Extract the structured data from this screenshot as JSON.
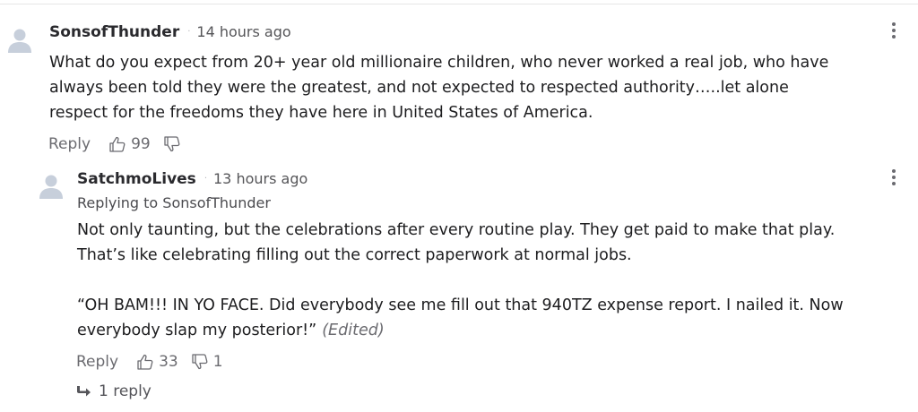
{
  "comments": [
    {
      "username": "SonsofThunder",
      "separator": "·",
      "time": "14 hours ago",
      "body_lines": [
        "What do you expect from 20+ year old millionaire children, who never worked a real job, who have",
        "always been told they were the greatest, and not expected to respected authority…..let alone",
        "respect for the freedoms they have here in United States of America."
      ],
      "reply_label": "Reply",
      "upvotes": "99",
      "downvotes": ""
    },
    {
      "username": "SatchmoLives",
      "separator": "·",
      "time": "13 hours ago",
      "replying_to": "Replying to SonsofThunder",
      "body_lines": [
        "Not only taunting, but the celebrations after every routine play. They get paid to make that play.",
        "That’s like celebrating filling out the correct paperwork at normal jobs.",
        "",
        "“OH BAM!!! IN YO FACE. Did everybody see me fill out that 940TZ expense report. I nailed it. Now",
        "everybody slap my posterior!”"
      ],
      "edited_label": "(Edited)",
      "reply_label": "Reply",
      "upvotes": "33",
      "downvotes": "1",
      "replies_label": "1 reply"
    }
  ],
  "icons": {
    "avatar": "user-avatar-icon",
    "thumbs_up": "thumbs-up-icon",
    "thumbs_down": "thumbs-down-icon",
    "more": "more-options-icon",
    "replies_arrow": "reply-arrow-icon"
  },
  "colors": {
    "avatar": "#c7cfdb",
    "text": "#1d1d1f",
    "muted": "#6b6b70"
  }
}
